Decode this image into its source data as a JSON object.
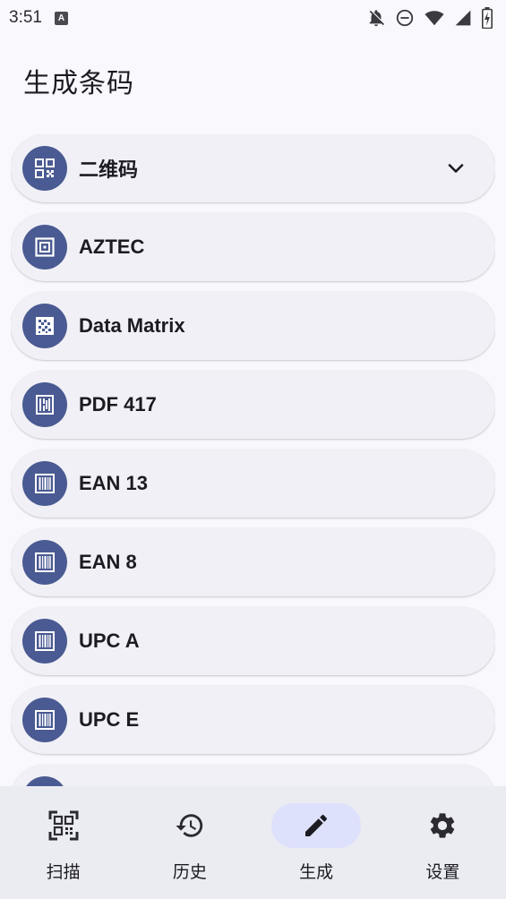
{
  "status_bar": {
    "time": "3:51",
    "notification_icon": "a-icon"
  },
  "header": {
    "title": "生成条码"
  },
  "list": {
    "items": [
      {
        "label": "二维码",
        "icon": "qr-code-icon",
        "expandable": true
      },
      {
        "label": "AZTEC",
        "icon": "aztec-icon"
      },
      {
        "label": "Data Matrix",
        "icon": "data-matrix-icon"
      },
      {
        "label": "PDF 417",
        "icon": "pdf417-icon"
      },
      {
        "label": "EAN 13",
        "icon": "barcode-icon"
      },
      {
        "label": "EAN 8",
        "icon": "barcode-icon"
      },
      {
        "label": "UPC A",
        "icon": "barcode-icon"
      },
      {
        "label": "UPC E",
        "icon": "barcode-icon"
      }
    ]
  },
  "bottom_nav": {
    "items": [
      {
        "label": "扫描",
        "icon": "qr-scan-icon"
      },
      {
        "label": "历史",
        "icon": "history-icon"
      },
      {
        "label": "生成",
        "icon": "pencil-icon",
        "active": true
      },
      {
        "label": "设置",
        "icon": "gear-icon"
      }
    ]
  },
  "colors": {
    "background": "#f8f8fd",
    "item_background": "#f0f0f6",
    "icon_circle": "#4a5a92",
    "nav_background": "#ebebf2",
    "nav_active_pill": "#dde1fb"
  }
}
